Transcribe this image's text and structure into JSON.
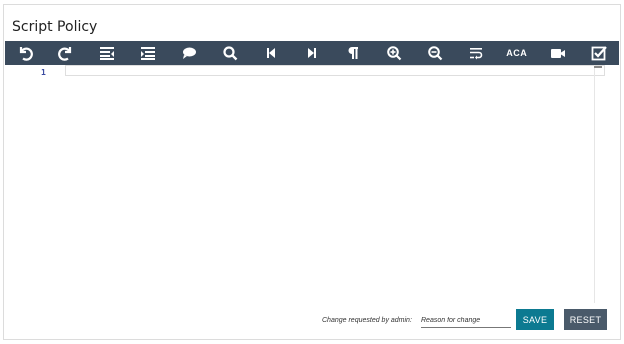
{
  "title": "Script Policy",
  "toolbar": {
    "items": [
      {
        "name": "undo-icon"
      },
      {
        "name": "redo-icon"
      },
      {
        "name": "outdent-icon"
      },
      {
        "name": "indent-icon"
      },
      {
        "name": "comment-icon"
      },
      {
        "name": "search-icon"
      },
      {
        "name": "previous-icon"
      },
      {
        "name": "next-icon"
      },
      {
        "name": "pilcrow-icon"
      },
      {
        "name": "zoom-in-icon"
      },
      {
        "name": "zoom-out-icon"
      },
      {
        "name": "word-wrap-icon"
      },
      {
        "name": "aca-button",
        "label": "ACA"
      },
      {
        "name": "video-icon"
      },
      {
        "name": "check-square-icon"
      }
    ],
    "color": "#3a4a5c"
  },
  "editor": {
    "line_numbers": [
      "1"
    ]
  },
  "footer": {
    "change_label": "Change requested by admin:",
    "reason_placeholder": "Reason for change",
    "save_label": "SAVE",
    "reset_label": "RESET"
  },
  "colors": {
    "save": "#0c7a91",
    "reset": "#4a5a6a"
  }
}
